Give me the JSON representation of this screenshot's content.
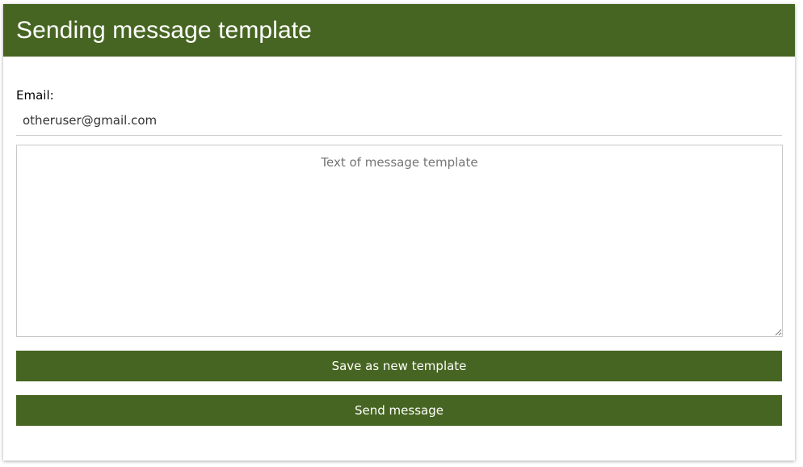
{
  "header": {
    "title": "Sending message template"
  },
  "form": {
    "email_label": "Email:",
    "email_value": "otheruser@gmail.com",
    "message_placeholder": "Text of message template",
    "save_label": "Save as new template",
    "send_label": "Send message"
  },
  "colors": {
    "accent": "#476522"
  }
}
